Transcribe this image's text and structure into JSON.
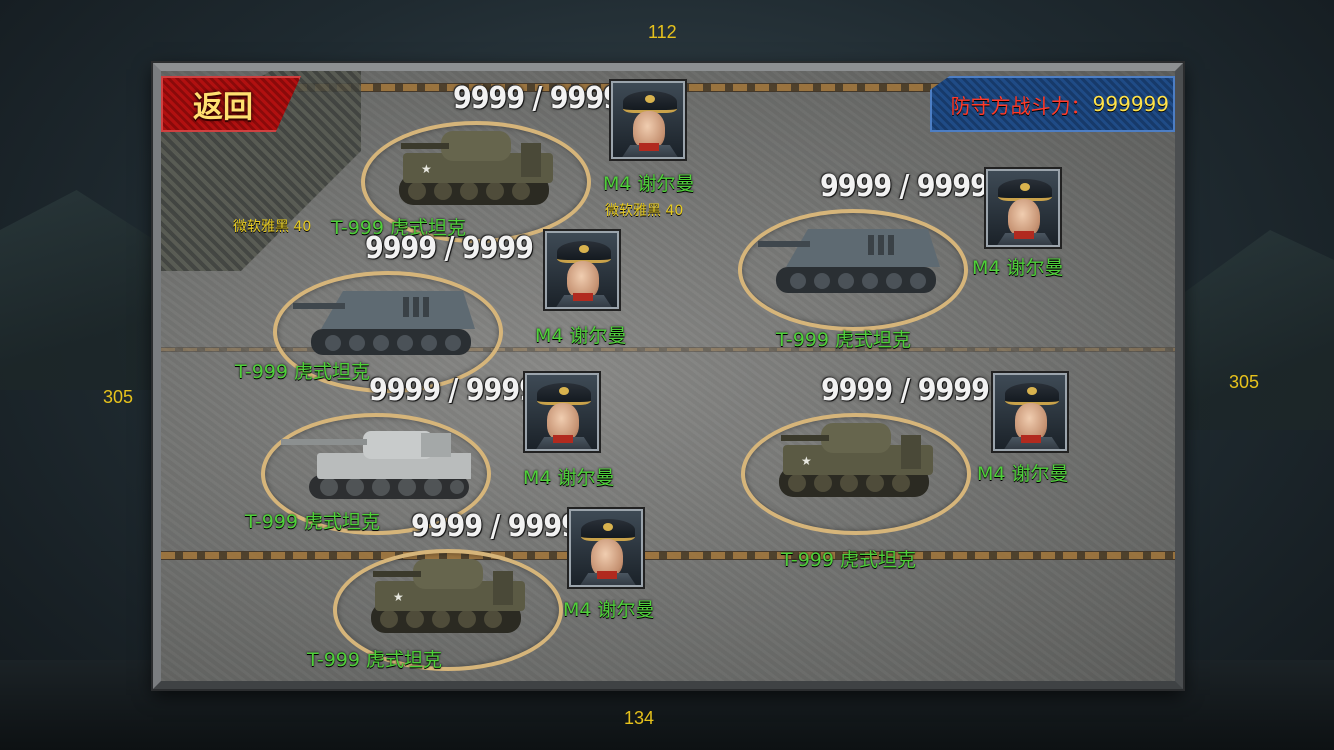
{
  "margins": {
    "top": "112",
    "bottom": "134",
    "left": "305",
    "right": "305"
  },
  "header": {
    "back_label": "返回",
    "power_label": "防守方战斗力：",
    "power_value": "999999"
  },
  "debug_labels": [
    "微软雅黑 40",
    "微软雅黑 40"
  ],
  "units": [
    {
      "hp": "9999 / 9999",
      "commander": "M4 谢尔曼",
      "tank_name": "T-999 虎式坦克",
      "tank_model": "light-tank"
    },
    {
      "hp": "9999 / 9999",
      "commander": "M4 谢尔曼",
      "tank_name": "T-999 虎式坦克",
      "tank_model": "tank-destroyer"
    },
    {
      "hp": "9999 / 9999",
      "commander": "M4 谢尔曼",
      "tank_name": "T-999 虎式坦克",
      "tank_model": "tank-destroyer"
    },
    {
      "hp": "9999 / 9999",
      "commander": "M4 谢尔曼",
      "tank_name": "T-999 虎式坦克",
      "tank_model": "tiger-tank"
    },
    {
      "hp": "9999 / 9999",
      "commander": "M4 谢尔曼",
      "tank_name": "T-999 虎式坦克",
      "tank_model": "light-tank"
    },
    {
      "hp": "9999 / 9999",
      "commander": "M4 谢尔曼",
      "tank_name": "T-999 虎式坦克",
      "tank_model": "light-tank"
    }
  ],
  "colors": {
    "accent_gold": "#e7c21c",
    "name_green": "#4fd03a",
    "back_red": "#b11010",
    "power_blue": "#1f4b86"
  }
}
